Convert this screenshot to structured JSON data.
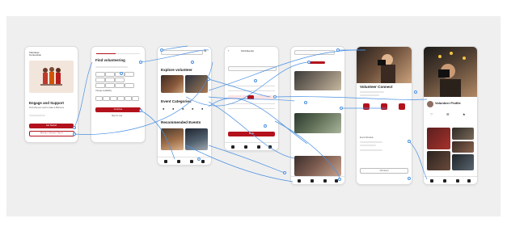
{
  "screens": {
    "welcome": {
      "header_label": "Volunteer Connection",
      "title": "Engage and Support",
      "subtitle": "Find what you need to make a difference",
      "primary_button": "Get Started",
      "secondary_button": "Already a Volunteer? Sign In"
    },
    "find": {
      "title": "Find volunteering",
      "secondary_label": "Change availability",
      "continue_button": "Continue",
      "skip_link": "Skip for now"
    },
    "explore": {
      "explore_heading": "Explore volunteer",
      "categories_heading": "Event Categories",
      "recommended_heading": "Recommended Events"
    },
    "calendar": {
      "title": "Find Events",
      "apply_button": "Book"
    },
    "events": {
      "search_placeholder": "Search events"
    },
    "detail": {
      "title": "Volunteer Connect",
      "section_label": "Event Schedule",
      "action_button": "Join Event"
    },
    "profile": {
      "title": "Volunteer Profile"
    }
  },
  "colors": {
    "accent": "#b3121c",
    "connector": "#4a90e2",
    "board": "#efefef"
  }
}
